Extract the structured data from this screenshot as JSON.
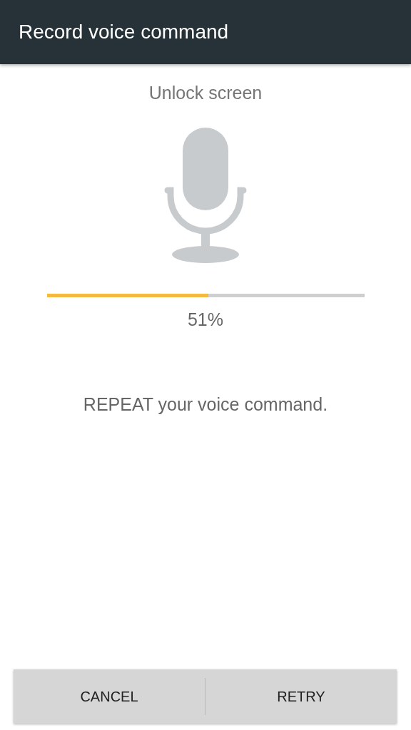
{
  "header": {
    "title": "Record voice command"
  },
  "subtitle": "Unlock screen",
  "progress": {
    "level": 0.51,
    "reading": "51%"
  },
  "instruction": "REPEAT your voice command.",
  "buttons": [
    {
      "label": "CANCEL"
    },
    {
      "label": "RETRY"
    }
  ]
}
